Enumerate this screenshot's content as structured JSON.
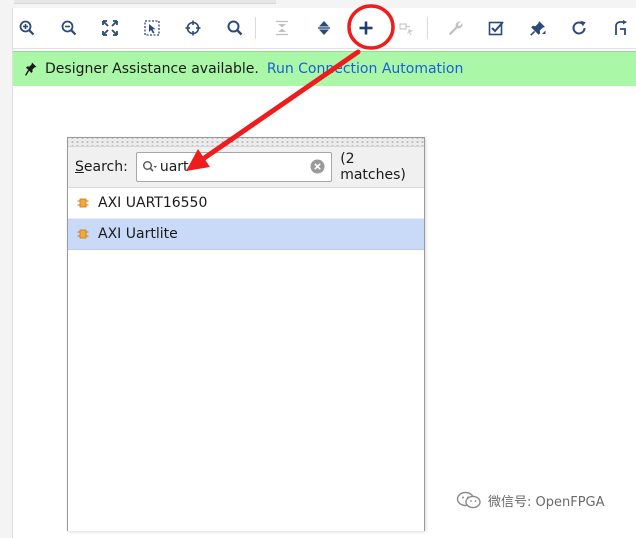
{
  "toolbar": {
    "buttons": [
      {
        "icon": "zoom-in-icon"
      },
      {
        "icon": "zoom-out-icon"
      },
      {
        "icon": "zoom-fit-icon"
      },
      {
        "icon": "zoom-area-icon"
      },
      {
        "icon": "auto-fit-selection-icon"
      },
      {
        "icon": "search-icon"
      },
      {
        "icon": "collapse-all-icon"
      },
      {
        "icon": "expand-all-icon"
      },
      {
        "icon": "add-ip-icon"
      },
      {
        "icon": "make-connection-icon"
      },
      {
        "icon": "wrench-icon"
      },
      {
        "icon": "validate-design-icon"
      },
      {
        "icon": "pin-icon"
      },
      {
        "icon": "regenerate-layout-icon"
      },
      {
        "icon": "optimize-routing-icon"
      }
    ]
  },
  "banner": {
    "message": "Designer Assistance available.",
    "link": "Run Connection Automation",
    "color": "#aaf7a7",
    "link_color": "#1a5fd6"
  },
  "popup": {
    "search_label_accel": "S",
    "search_label_rest": "earch:",
    "search_value": "uart",
    "match_count": "(2 matches)",
    "results": [
      {
        "label": "AXI UART16550",
        "selected": false
      },
      {
        "label": "AXI Uartlite",
        "selected": true
      }
    ],
    "selected_color": "#c8daf7"
  },
  "annotation": {
    "color": "#ee1c1c"
  },
  "watermark": {
    "text": "微信号: OpenFPGA"
  }
}
